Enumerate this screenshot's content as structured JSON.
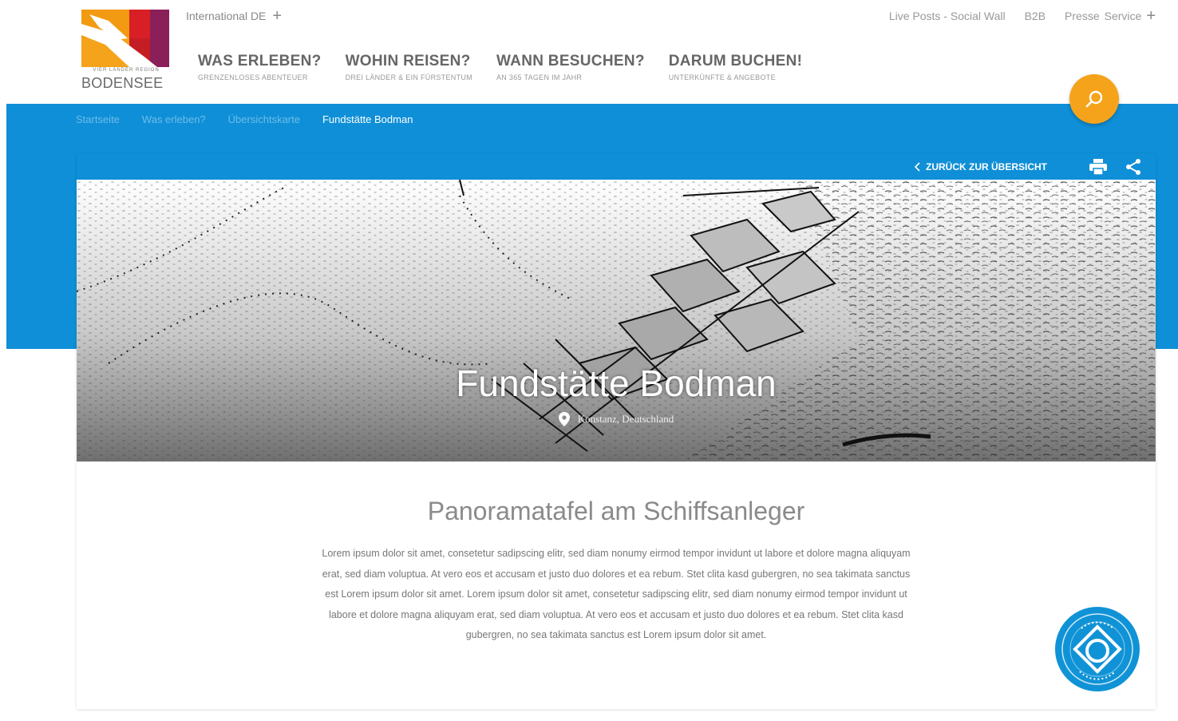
{
  "brand": {
    "logo_sub": "VIER LÄNDER REGION",
    "logo_main": "BODENSEE"
  },
  "header": {
    "international_label": "International DE",
    "top_links": [
      "Live Posts - Social Wall",
      "B2B",
      "Presse",
      "Service"
    ],
    "nav": [
      {
        "title": "WAS ERLEBEN?",
        "subtitle": "GRENZENLOSES ABENTEUER"
      },
      {
        "title": "WOHIN REISEN?",
        "subtitle": "DREI LÄNDER & EIN FÜRSTENTUM"
      },
      {
        "title": "WANN BESUCHEN?",
        "subtitle": "AN 365 TAGEN IM JAHR"
      },
      {
        "title": "DARUM BUCHEN!",
        "subtitle": "UNTERKÜNFTE & ANGEBOTE"
      }
    ],
    "search_icon": "search-icon"
  },
  "breadcrumb": [
    "Startseite",
    "Was erleben?",
    "Übersichtskarte",
    "Fundstätte Bodman"
  ],
  "toolbar": {
    "back_label": "ZURÜCK ZUR ÜBERSICHT",
    "print_icon": "print-icon",
    "share_icon": "share-icon"
  },
  "hero": {
    "title": "Fundstätte Bodman",
    "location": "Konstanz, Deutschland"
  },
  "content": {
    "title": "Panoramatafel am Schiffsanleger",
    "text": "Lorem ipsum dolor sit amet, consetetur sadipscing elitr, sed diam nonumy eirmod tempor invidunt ut labore et dolore magna aliquyam erat, sed diam voluptua. At vero eos et accusam et justo duo dolores et ea rebum. Stet clita kasd gubergren, no sea takimata sanctus est Lorem ipsum dolor sit amet. Lorem ipsum dolor sit amet, consetetur sadipscing elitr, sed diam nonumy eirmod tempor invidunt ut labore et dolore magna aliquyam erat, sed diam voluptua. At vero eos et accusam et justo duo dolores et ea rebum. Stet clita kasd gubergren, no sea takimata sanctus est Lorem ipsum dolor sit amet."
  },
  "colors": {
    "accent_blue": "#0f8fd7",
    "accent_orange": "#f5a31a"
  }
}
